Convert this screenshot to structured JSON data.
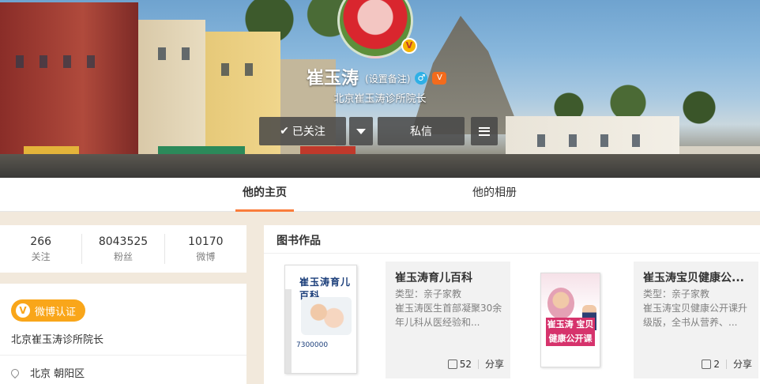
{
  "profile": {
    "name": "崔玉涛",
    "remark": "(设置备注)",
    "gender_symbol": "♂",
    "vip_badge": "V",
    "avatar_badge": "V",
    "verified_title": "北京崔玉涛诊所院长"
  },
  "actions": {
    "follow_check": "✔",
    "follow_label": "已关注",
    "message_label": "私信"
  },
  "tabs": [
    {
      "label": "他的主页"
    },
    {
      "label": "他的相册"
    }
  ],
  "stats": [
    {
      "value": "266",
      "label": "关注"
    },
    {
      "value": "8043525",
      "label": "粉丝"
    },
    {
      "value": "10170",
      "label": "微博"
    }
  ],
  "info": {
    "verify_badge_letter": "V",
    "verify_badge_label": "微博认证",
    "verify_title": "北京崔玉涛诊所院长",
    "location": "北京 朝阳区"
  },
  "books": {
    "section_title": "图书作品",
    "share_label": "分享",
    "items": [
      {
        "title": "崔玉涛育儿百科",
        "type": "类型：亲子家教",
        "desc": "崔玉涛医生首部凝聚30余年儿科从医经验和...",
        "likes": "52",
        "cover_title": "崔玉涛育儿百科",
        "cover_num": "7300000"
      },
      {
        "title": "崔玉涛宝贝健康公...",
        "type": "类型：亲子家教",
        "desc": "崔玉涛宝贝健康公开课升级版，全书从营养、...",
        "likes": "2",
        "cover_title": "崔玉涛 宝贝健康公开课"
      }
    ]
  },
  "colors": {
    "accent": "#fa7d3c",
    "verify": "#f9a61a",
    "page_bg": "#f2e9dc"
  }
}
